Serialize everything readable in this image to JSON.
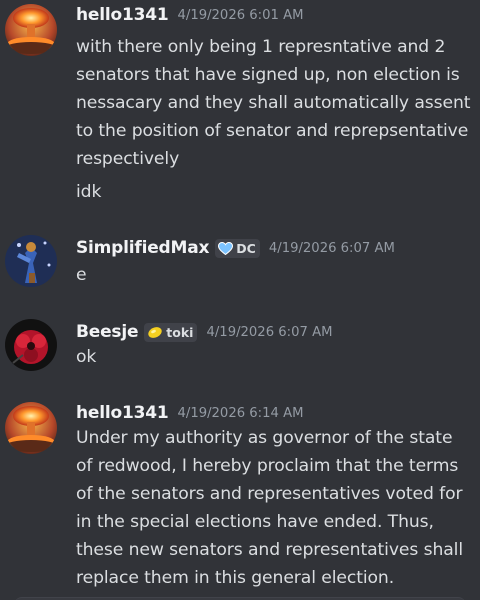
{
  "messages": [
    {
      "author": "hello1341",
      "timestamp": "4/19/2026 6:01 AM",
      "avatar": "nuclear-explosion-avatar",
      "lines": [
        "with there only being 1 represntative and 2",
        "senators that have signed up, non election is",
        "nessacary and they shall automatically assent",
        "to the position of senator and reprepsentative",
        "respectively",
        "idk"
      ]
    },
    {
      "author": "SimplifiedMax",
      "timestamp": "4/19/2026 6:07 AM",
      "avatar": "blue-figure-avatar",
      "tag": {
        "icon": "blue-heart-icon",
        "label": "DC",
        "color": "#7cc3ff"
      },
      "lines": [
        "e"
      ]
    },
    {
      "author": "Beesje",
      "timestamp": "4/19/2026 6:07 AM",
      "avatar": "red-flower-avatar",
      "tag": {
        "icon": "lemon-icon",
        "label": "toki",
        "color": "#f5d020"
      },
      "lines": [
        "ok"
      ]
    },
    {
      "author": "hello1341",
      "timestamp": "4/19/2026 6:14 AM",
      "avatar": "nuclear-explosion-avatar",
      "lines": [
        "Under my authority as governor of the state",
        "of redwood, I hereby proclaim that the terms",
        "of the senators and representatives voted for",
        "in the special elections have ended. Thus,",
        "these new senators and representatives shall",
        "replace them in this general election."
      ]
    }
  ],
  "colors": {
    "background": "#313338",
    "username": "#f2f3f5",
    "text": "#dbdee1",
    "timestamp": "#949ba4",
    "tag_background": "#404249"
  }
}
